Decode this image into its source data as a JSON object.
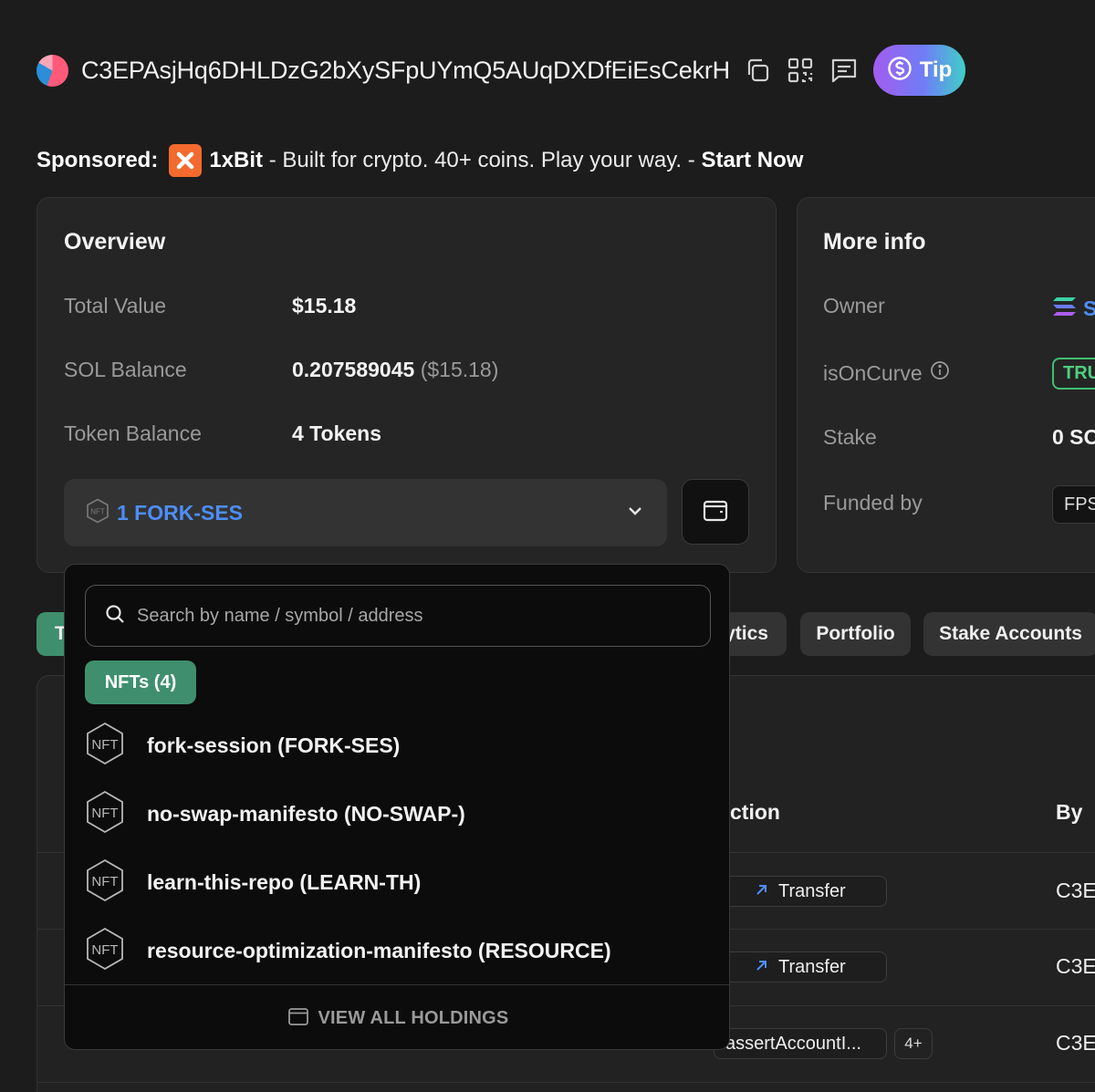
{
  "header": {
    "address": "C3EPAsjHq6DHLDzG2bXySFpUYmQ5AUqDXDfEiEsCekrH",
    "icons": [
      "copy-icon",
      "qr-code-icon",
      "message-icon"
    ],
    "tip_label": "Tip"
  },
  "sponsored": {
    "prefix": "Sponsored:",
    "brand": "1xBit",
    "text": " - Built for crypto. 40+ coins. Play your way. - ",
    "cta": "Start Now"
  },
  "overview": {
    "title": "Overview",
    "total_value_label": "Total Value",
    "total_value": "$15.18",
    "sol_balance_label": "SOL Balance",
    "sol_balance": "0.207589045",
    "sol_balance_usd": "($15.18)",
    "token_balance_label": "Token Balance",
    "token_balance": "4 Tokens",
    "selected_holding": "1 FORK-SES"
  },
  "more_info": {
    "title": "More info",
    "owner_label": "Owner",
    "owner_value": "S",
    "is_on_curve_label": "isOnCurve",
    "is_on_curve_value": "TRU",
    "stake_label": "Stake",
    "stake_value": "0 SO",
    "funded_by_label": "Funded by",
    "funded_by_value": "FPS"
  },
  "tabs": {
    "first": "T",
    "analytics": "ytics",
    "portfolio": "Portfolio",
    "stake_accounts": "Stake Accounts"
  },
  "table": {
    "col_action": "ction",
    "col_by": "By",
    "rows": [
      {
        "action": "Transfer",
        "by": "C3E"
      },
      {
        "action": "Transfer",
        "by": "C3E"
      },
      {
        "action": "assertAccountI...",
        "extra": "4+",
        "by": "C3E"
      }
    ]
  },
  "dropdown": {
    "search_placeholder": "Search by name / symbol / address",
    "chip_label": "NFTs (4)",
    "items": [
      {
        "name": "fork-session (FORK-SES)"
      },
      {
        "name": "no-swap-manifesto (NO-SWAP-)"
      },
      {
        "name": "learn-this-repo (LEARN-TH)"
      },
      {
        "name": "resource-optimization-manifesto (RESOURCE)"
      }
    ],
    "footer_label": "VIEW ALL HOLDINGS"
  },
  "colors": {
    "background": "#1c1c1c",
    "accent_green": "#3f8f6e",
    "link_blue": "#4d8ef7",
    "true_green": "#4fd07e"
  }
}
